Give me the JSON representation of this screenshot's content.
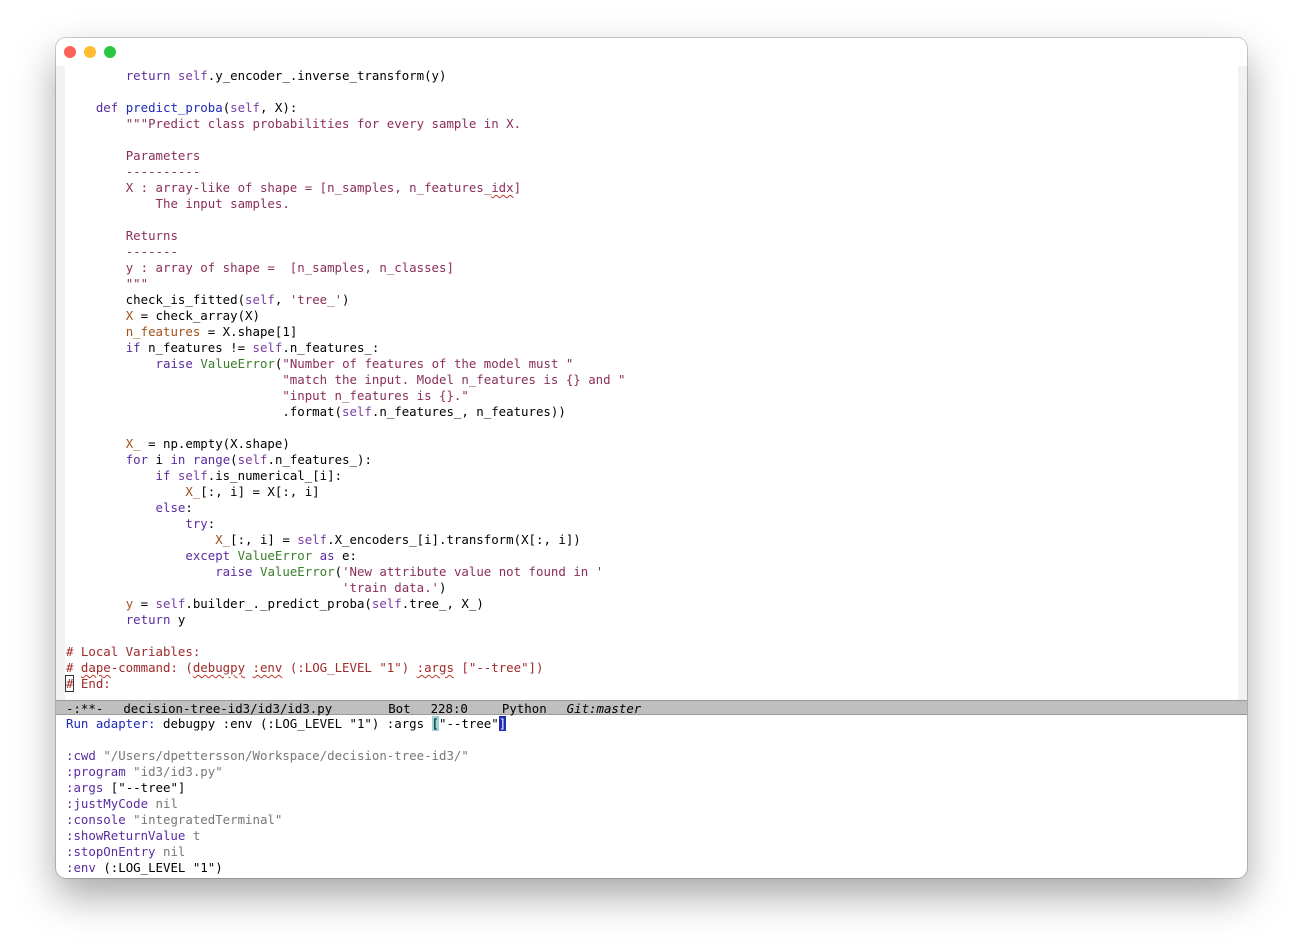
{
  "window": {
    "controls": [
      "close",
      "minimize",
      "zoom"
    ]
  },
  "editor": {
    "lines": [
      [
        {
          "t": "        "
        },
        {
          "t": "return",
          "c": "kw"
        },
        {
          "t": " "
        },
        {
          "t": "self",
          "c": "self"
        },
        {
          "t": ".y_encoder_.inverse_transform(y)"
        }
      ],
      [
        {
          "t": ""
        }
      ],
      [
        {
          "t": "    "
        },
        {
          "t": "def",
          "c": "kw"
        },
        {
          "t": " "
        },
        {
          "t": "predict_proba",
          "c": "fn"
        },
        {
          "t": "("
        },
        {
          "t": "self",
          "c": "self"
        },
        {
          "t": ", X):"
        }
      ],
      [
        {
          "t": "        "
        },
        {
          "t": "\"\"\"Predict class probabilities for every sample in X.",
          "c": "str"
        }
      ],
      [
        {
          "t": ""
        }
      ],
      [
        {
          "t": "        "
        },
        {
          "t": "Parameters",
          "c": "str"
        }
      ],
      [
        {
          "t": "        "
        },
        {
          "t": "----------",
          "c": "str"
        }
      ],
      [
        {
          "t": "        "
        },
        {
          "t": "X : array-like of shape = [n_samples, n_features_",
          "c": "str"
        },
        {
          "t": "idx",
          "c": "str wavy"
        },
        {
          "t": "]",
          "c": "str"
        }
      ],
      [
        {
          "t": "            "
        },
        {
          "t": "The input samples.",
          "c": "str"
        }
      ],
      [
        {
          "t": ""
        }
      ],
      [
        {
          "t": "        "
        },
        {
          "t": "Returns",
          "c": "str"
        }
      ],
      [
        {
          "t": "        "
        },
        {
          "t": "-------",
          "c": "str"
        }
      ],
      [
        {
          "t": "        "
        },
        {
          "t": "y : array of shape =  [n_samples, n_classes]",
          "c": "str"
        }
      ],
      [
        {
          "t": "        "
        },
        {
          "t": "\"\"\"",
          "c": "str"
        }
      ],
      [
        {
          "t": "        check_is_fitted("
        },
        {
          "t": "self",
          "c": "self"
        },
        {
          "t": ", "
        },
        {
          "t": "'tree_'",
          "c": "str"
        },
        {
          "t": ")"
        }
      ],
      [
        {
          "t": "        "
        },
        {
          "t": "X",
          "c": "var"
        },
        {
          "t": " = check_array(X)"
        }
      ],
      [
        {
          "t": "        "
        },
        {
          "t": "n_features",
          "c": "var"
        },
        {
          "t": " = X.shape[1]"
        }
      ],
      [
        {
          "t": "        "
        },
        {
          "t": "if",
          "c": "kw"
        },
        {
          "t": " n_features != "
        },
        {
          "t": "self",
          "c": "self"
        },
        {
          "t": ".n_features_:"
        }
      ],
      [
        {
          "t": "            "
        },
        {
          "t": "raise",
          "c": "kw"
        },
        {
          "t": " "
        },
        {
          "t": "ValueError",
          "c": "bi"
        },
        {
          "t": "("
        },
        {
          "t": "\"Number of features of the model must \"",
          "c": "str"
        }
      ],
      [
        {
          "t": "                             "
        },
        {
          "t": "\"match the input. Model n_features is {} and \"",
          "c": "str"
        }
      ],
      [
        {
          "t": "                             "
        },
        {
          "t": "\"input n_features is {}.\"",
          "c": "str"
        }
      ],
      [
        {
          "t": "                             .format("
        },
        {
          "t": "self",
          "c": "self"
        },
        {
          "t": ".n_features_, n_features))"
        }
      ],
      [
        {
          "t": ""
        }
      ],
      [
        {
          "t": "        "
        },
        {
          "t": "X_",
          "c": "var"
        },
        {
          "t": " = np.empty(X.shape)"
        }
      ],
      [
        {
          "t": "        "
        },
        {
          "t": "for",
          "c": "kw"
        },
        {
          "t": " i "
        },
        {
          "t": "in",
          "c": "kw"
        },
        {
          "t": " "
        },
        {
          "t": "range",
          "c": "kw"
        },
        {
          "t": "("
        },
        {
          "t": "self",
          "c": "self"
        },
        {
          "t": ".n_features_):"
        }
      ],
      [
        {
          "t": "            "
        },
        {
          "t": "if",
          "c": "kw"
        },
        {
          "t": " "
        },
        {
          "t": "self",
          "c": "self"
        },
        {
          "t": ".is_numerical_[i]:"
        }
      ],
      [
        {
          "t": "                "
        },
        {
          "t": "X_",
          "c": "var"
        },
        {
          "t": "[:, i] = X[:, i]"
        }
      ],
      [
        {
          "t": "            "
        },
        {
          "t": "else",
          "c": "kw"
        },
        {
          "t": ":"
        }
      ],
      [
        {
          "t": "                "
        },
        {
          "t": "try",
          "c": "kw"
        },
        {
          "t": ":"
        }
      ],
      [
        {
          "t": "                    "
        },
        {
          "t": "X_",
          "c": "var"
        },
        {
          "t": "[:, i] = "
        },
        {
          "t": "self",
          "c": "self"
        },
        {
          "t": ".X_encoders_[i].transform(X[:, i])"
        }
      ],
      [
        {
          "t": "                "
        },
        {
          "t": "except",
          "c": "kw"
        },
        {
          "t": " "
        },
        {
          "t": "ValueError",
          "c": "bi"
        },
        {
          "t": " "
        },
        {
          "t": "as",
          "c": "kw"
        },
        {
          "t": " e:"
        }
      ],
      [
        {
          "t": "                    "
        },
        {
          "t": "raise",
          "c": "kw"
        },
        {
          "t": " "
        },
        {
          "t": "ValueError",
          "c": "bi"
        },
        {
          "t": "("
        },
        {
          "t": "'New attribute value not found in '",
          "c": "str"
        }
      ],
      [
        {
          "t": "                                     "
        },
        {
          "t": "'train data.'",
          "c": "str"
        },
        {
          "t": ")"
        }
      ],
      [
        {
          "t": "        "
        },
        {
          "t": "y",
          "c": "var"
        },
        {
          "t": " = "
        },
        {
          "t": "self",
          "c": "self"
        },
        {
          "t": ".builder_._predict_proba("
        },
        {
          "t": "self",
          "c": "self"
        },
        {
          "t": ".tree_, X_)"
        }
      ],
      [
        {
          "t": "        "
        },
        {
          "t": "return",
          "c": "kw"
        },
        {
          "t": " y"
        }
      ],
      [
        {
          "t": ""
        }
      ],
      [
        {
          "t": "# Local Variables:",
          "c": "cmt"
        }
      ],
      [
        {
          "t": "# ",
          "c": "cmt"
        },
        {
          "t": "dape",
          "c": "cmt wavy"
        },
        {
          "t": "-command: (",
          "c": "cmt"
        },
        {
          "t": "debugpy",
          "c": "cmt wavy"
        },
        {
          "t": " ",
          "c": "cmt"
        },
        {
          "t": ":env",
          "c": "cmt wavy"
        },
        {
          "t": " (:LOG_LEVEL \"1\") ",
          "c": "cmt"
        },
        {
          "t": ":args",
          "c": "cmt wavy"
        },
        {
          "t": " [\"--tree\"])",
          "c": "cmt"
        }
      ],
      [
        {
          "t": "#",
          "c": "cmt cursor"
        },
        {
          "t": " End:",
          "c": "cmt"
        }
      ]
    ]
  },
  "modeline": {
    "status": "-:**-",
    "buffer": "decision-tree-id3/id3/id3.py",
    "position": "Bot",
    "line_col": "228:0",
    "mode": "Python",
    "vc": "Git:master"
  },
  "minibuffer": {
    "prompt": "Run adapter:",
    "input_before": " debugpy :env (:LOG_LEVEL \"1\") :args ",
    "input_open": "[",
    "input_mid": "\"--tree\"",
    "input_close": "]",
    "completions": [
      {
        "key": ":cwd",
        "value": "\"/Users/dpettersson/Workspace/decision-tree-id3/\"",
        "kind": "sval"
      },
      {
        "key": ":program",
        "value": "\"id3/id3.py\"",
        "kind": "sval"
      },
      {
        "key": ":args",
        "value": "[\"--tree\"]",
        "kind": "plain"
      },
      {
        "key": ":justMyCode",
        "value": "nil",
        "kind": "nilv"
      },
      {
        "key": ":console",
        "value": "\"integratedTerminal\"",
        "kind": "sval"
      },
      {
        "key": ":showReturnValue",
        "value": "t",
        "kind": "nilv"
      },
      {
        "key": ":stopOnEntry",
        "value": "nil",
        "kind": "nilv"
      },
      {
        "key": ":env",
        "value": "(:LOG_LEVEL \"1\")",
        "kind": "plain"
      }
    ]
  }
}
